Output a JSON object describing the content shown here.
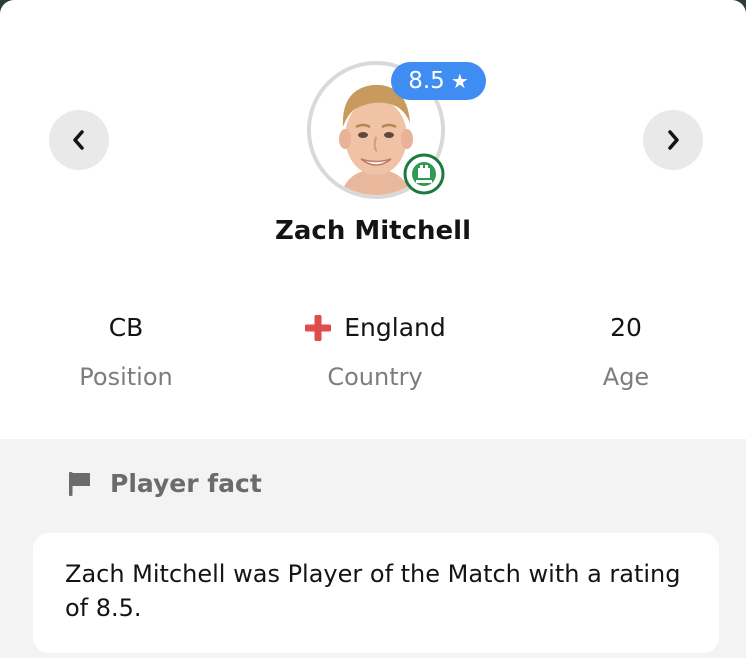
{
  "navigation": {
    "prev_icon": "chevron-left-icon",
    "next_icon": "chevron-right-icon"
  },
  "player": {
    "name": "Zach Mitchell",
    "rating": "8.5",
    "rating_icon": "star-icon",
    "avatar_icon": "player-photo",
    "club_crest_icon": "club-crest-icon"
  },
  "stats": {
    "position": {
      "value": "CB",
      "label": "Position"
    },
    "country": {
      "value": "England",
      "label": "Country",
      "flag_icon": "england-flag-icon"
    },
    "age": {
      "value": "20",
      "label": "Age"
    }
  },
  "fact": {
    "icon": "flag-icon",
    "title": "Player fact",
    "text": "Zach Mitchell was Player of the Match with a rating of 8.5."
  },
  "colors": {
    "rating_badge": "#3f8cf2",
    "nav_button_bg": "#e9e9e9",
    "fact_background": "#f3f3f3",
    "england_cross": "#e04b4b",
    "muted_text": "#7d7d7d"
  }
}
